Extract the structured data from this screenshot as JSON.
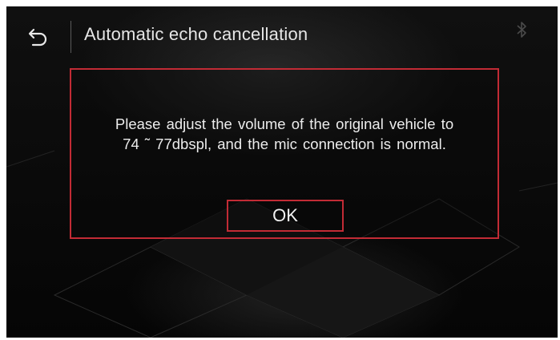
{
  "header": {
    "title": "Automatic echo cancellation",
    "back_icon": "back-arrow-icon",
    "status_icon": "bluetooth-icon"
  },
  "dialog": {
    "message_line1": "Please adjust the volume of the original vehicle to",
    "message_line2": "74 ˜ 77dbspl,  and the mic connection is normal.",
    "ok_label": "OK"
  },
  "colors": {
    "accent": "#c22b35",
    "background": "#0b0b0b",
    "text": "#ececec"
  }
}
